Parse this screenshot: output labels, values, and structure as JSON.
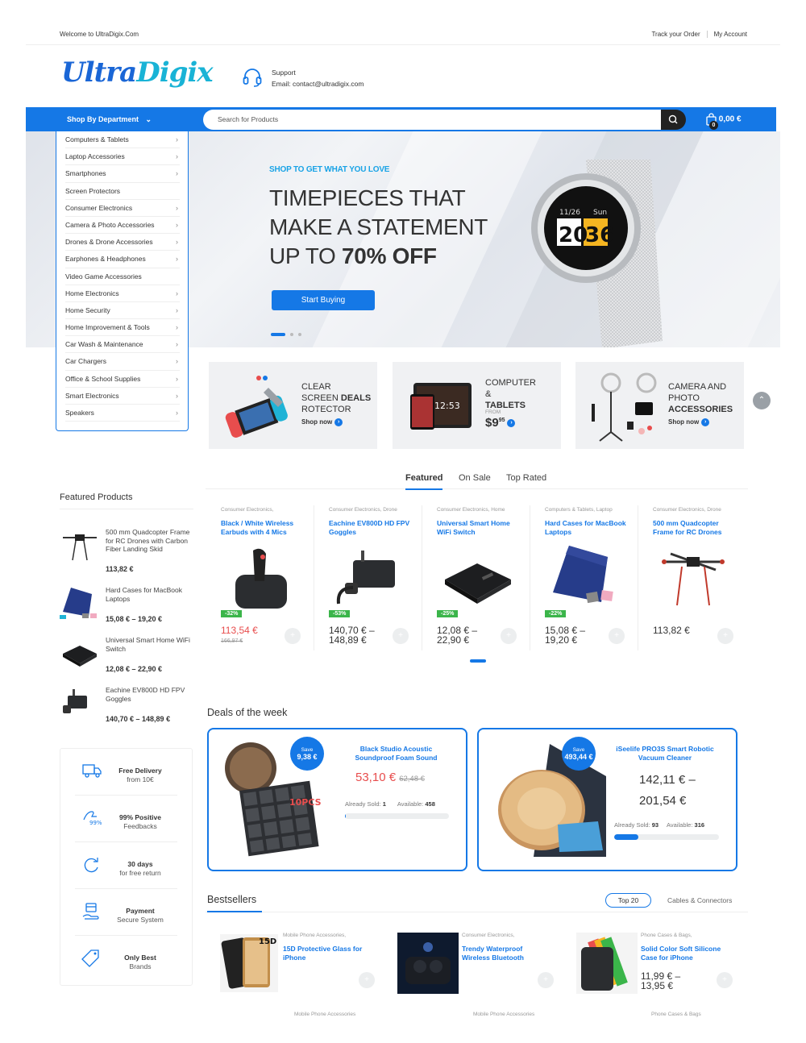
{
  "topbar": {
    "welcome": "Welcome to UltraDigix.Com",
    "track": "Track your Order",
    "account": "My Account"
  },
  "brand": {
    "logo_part1": "Ultra",
    "logo_part2": "Digix"
  },
  "support": {
    "label": "Support",
    "email": "Email: contact@ultradigix.com"
  },
  "nav": {
    "department_label": "Shop By Department",
    "search_placeholder": "Search for Products",
    "cart_total": "0,00 €",
    "cart_count": "0"
  },
  "departments": [
    {
      "label": "Computers & Tablets",
      "has_sub": true
    },
    {
      "label": "Laptop Accessories",
      "has_sub": true
    },
    {
      "label": "Smartphones",
      "has_sub": true
    },
    {
      "label": "Screen Protectors",
      "has_sub": false
    },
    {
      "label": "Consumer Electronics",
      "has_sub": true
    },
    {
      "label": "Camera & Photo Accessories",
      "has_sub": true
    },
    {
      "label": "Drones & Drone Accessories",
      "has_sub": true
    },
    {
      "label": "Earphones & Headphones",
      "has_sub": true
    },
    {
      "label": "Video Game Accessories",
      "has_sub": false
    },
    {
      "label": "Home Electronics",
      "has_sub": true
    },
    {
      "label": "Home Security",
      "has_sub": true
    },
    {
      "label": "Home Improvement & Tools",
      "has_sub": true
    },
    {
      "label": "Car Wash & Maintenance",
      "has_sub": true
    },
    {
      "label": "Car Chargers",
      "has_sub": true
    },
    {
      "label": "Office & School Supplies",
      "has_sub": true
    },
    {
      "label": "Smart Electronics",
      "has_sub": true
    },
    {
      "label": "Speakers",
      "has_sub": true
    }
  ],
  "hero": {
    "subtitle": "SHOP TO GET WHAT YOU LOVE",
    "line1": "TIMEPIECES THAT",
    "line2": "MAKE A STATEMENT",
    "line3_prefix": "UP TO ",
    "line3_bold": "70% OFF",
    "button": "Start Buying",
    "watch_date": "11/26",
    "watch_day": "Sun",
    "watch_h": "20",
    "watch_m": "36"
  },
  "banners": [
    {
      "l1": "CLEAR",
      "l2": "SCREEN ",
      "l2b": "DEALS",
      "l3": "ROTECTOR",
      "shop": "Shop now"
    },
    {
      "l1": "COMPUTER",
      "l2": "&",
      "l3": "TABLETS",
      "from": "FROM",
      "price": "$9",
      "cents": "95",
      "screen": "12:53"
    },
    {
      "l1": "CAMERA AND",
      "l2": "PHOTO",
      "l3": "ACCESSORIES",
      "shop": "Shop now"
    }
  ],
  "tabs": [
    "Featured",
    "On Sale",
    "Top Rated"
  ],
  "products": [
    {
      "cat": "Consumer Electronics,",
      "name": "Black / White Wireless Earbuds with 4 Mics",
      "disc": "-32%",
      "price": "113,54 €",
      "old": "166,97 €",
      "red": true
    },
    {
      "cat": "Consumer Electronics, Drone",
      "name": "Eachine EV800D HD FPV Goggles",
      "disc": "-53%",
      "price": "140,70 € –",
      "price2": "148,89 €"
    },
    {
      "cat": "Consumer Electronics, Home",
      "name": "Universal Smart Home WiFi Switch",
      "disc": "-25%",
      "price": "12,08 € –",
      "price2": "22,90 €"
    },
    {
      "cat": "Computers & Tablets, Laptop",
      "name": "Hard Cases for MacBook Laptops",
      "disc": "-22%",
      "price": "15,08 € –",
      "price2": "19,20 €"
    },
    {
      "cat": "Consumer Electronics, Drone",
      "name": "500 mm Quadcopter Frame for RC Drones",
      "price": "113,82 €"
    }
  ],
  "featured": {
    "title": "Featured Products",
    "items": [
      {
        "name": "500 mm Quadcopter Frame for RC Drones with Carbon Fiber Landing Skid",
        "price": "113,82 €"
      },
      {
        "name": "Hard Cases for MacBook Laptops",
        "price": "15,08 € – 19,20 €"
      },
      {
        "name": "Universal Smart Home WiFi Switch",
        "price": "12,08 € – 22,90 €"
      },
      {
        "name": "Eachine EV800D HD FPV Goggles",
        "price": "140,70 € – 148,89 €"
      }
    ]
  },
  "features": [
    {
      "title": "Free Delivery",
      "sub": "from 10€",
      "icon": "truck-icon"
    },
    {
      "title": "99% Positive",
      "sub": "Feedbacks",
      "icon": "feedback-icon",
      "badge": "99%"
    },
    {
      "title": "30 days",
      "sub": "for free return",
      "icon": "return-icon"
    },
    {
      "title": "Payment",
      "sub": "Secure System",
      "icon": "payment-icon"
    },
    {
      "title": "Only Best",
      "sub": "Brands",
      "icon": "tag-icon"
    }
  ],
  "deals": {
    "title": "Deals of the week",
    "items": [
      {
        "save": "Save",
        "save_amount": "9,38 €",
        "name": "Black Studio Acoustic Soundproof Foam Sound",
        "price": "53,10 €",
        "old": "62,48 €",
        "sold_label": "Already Sold:",
        "sold": "1",
        "avail_label": "Available:",
        "avail": "458",
        "progress": 0.002,
        "pcs": "10PCS"
      },
      {
        "save": "Save",
        "save_amount": "493,44 €",
        "name": "iSeelife PRO3S Smart Robotic Vacuum Cleaner",
        "price": "142,11 € –",
        "price2": "201,54 €",
        "sold_label": "Already Sold:",
        "sold": "93",
        "avail_label": "Available:",
        "avail": "316",
        "progress": 0.23
      }
    ]
  },
  "bestsellers": {
    "title": "Bestsellers",
    "tab1": "Top 20",
    "tab2": "Cables & Connectors",
    "items": [
      {
        "cat": "Mobile Phone Accessories,",
        "name": "15D Protective Glass for iPhone",
        "img_label": "15D"
      },
      {
        "cat": "Consumer Electronics,",
        "name": "Trendy Waterproof Wireless Bluetooth"
      },
      {
        "cat": "Phone Cases & Bags,",
        "name": "Solid Color Soft Silicone Case for iPhone",
        "price": "11,99 € –",
        "price2": "13,95 €"
      }
    ],
    "next_row": [
      "Mobile Phone Accessories",
      "Mobile Phone Accessories",
      "Phone Cases & Bags"
    ]
  },
  "colors": {
    "primary": "#1578e6",
    "accent": "#19a3e6",
    "sale": "#e84d4d",
    "discount": "#3bb54a"
  }
}
